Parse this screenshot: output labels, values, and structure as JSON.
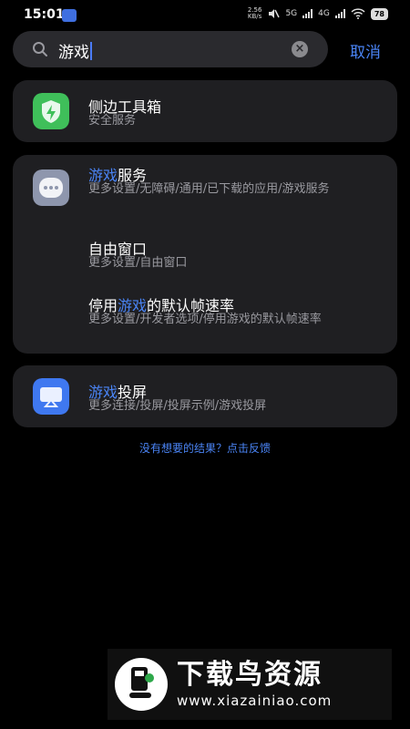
{
  "status_bar": {
    "time": "15:01",
    "net_speed_value": "2.56",
    "net_speed_unit": "KB/s",
    "signal_1": "5G",
    "signal_2": "4G",
    "battery": "78"
  },
  "search": {
    "query": "游戏",
    "cancel_label": "取消"
  },
  "results": [
    {
      "title_prefix": "",
      "title_highlight": "",
      "title_suffix": "侧边工具箱",
      "subtitle": "安全服务",
      "icon": "shield-bolt-icon",
      "icon_color": "#3fbf5a"
    },
    {
      "title_prefix": "",
      "title_highlight": "游戏",
      "title_suffix": "服务",
      "subtitle": "更多设置/无障碍/通用/已下载的应用/游戏服务",
      "icon": "more-dots-icon",
      "icon_color": "#8e96ad"
    },
    {
      "title_prefix": "",
      "title_highlight": "",
      "title_suffix": "自由窗口",
      "subtitle": "更多设置/自由窗口"
    },
    {
      "title_prefix": "停用",
      "title_highlight": "游戏",
      "title_suffix": "的默认帧速率",
      "subtitle": "更多设置/开发者选项/停用游戏的默认帧速率"
    },
    {
      "title_prefix": "",
      "title_highlight": "游戏",
      "title_suffix": "投屏",
      "subtitle": "更多连接/投屏/投屏示例/游戏投屏",
      "icon": "screen-cast-icon",
      "icon_color": "#3f78f0"
    }
  ],
  "feedback_text": "没有想要的结果？点击反馈",
  "watermark": {
    "title": "下载鸟资源",
    "url": "www.xiazainiao.com"
  },
  "colors": {
    "accent": "#4a84f5",
    "card": "#1f1f22",
    "background": "#000000"
  }
}
